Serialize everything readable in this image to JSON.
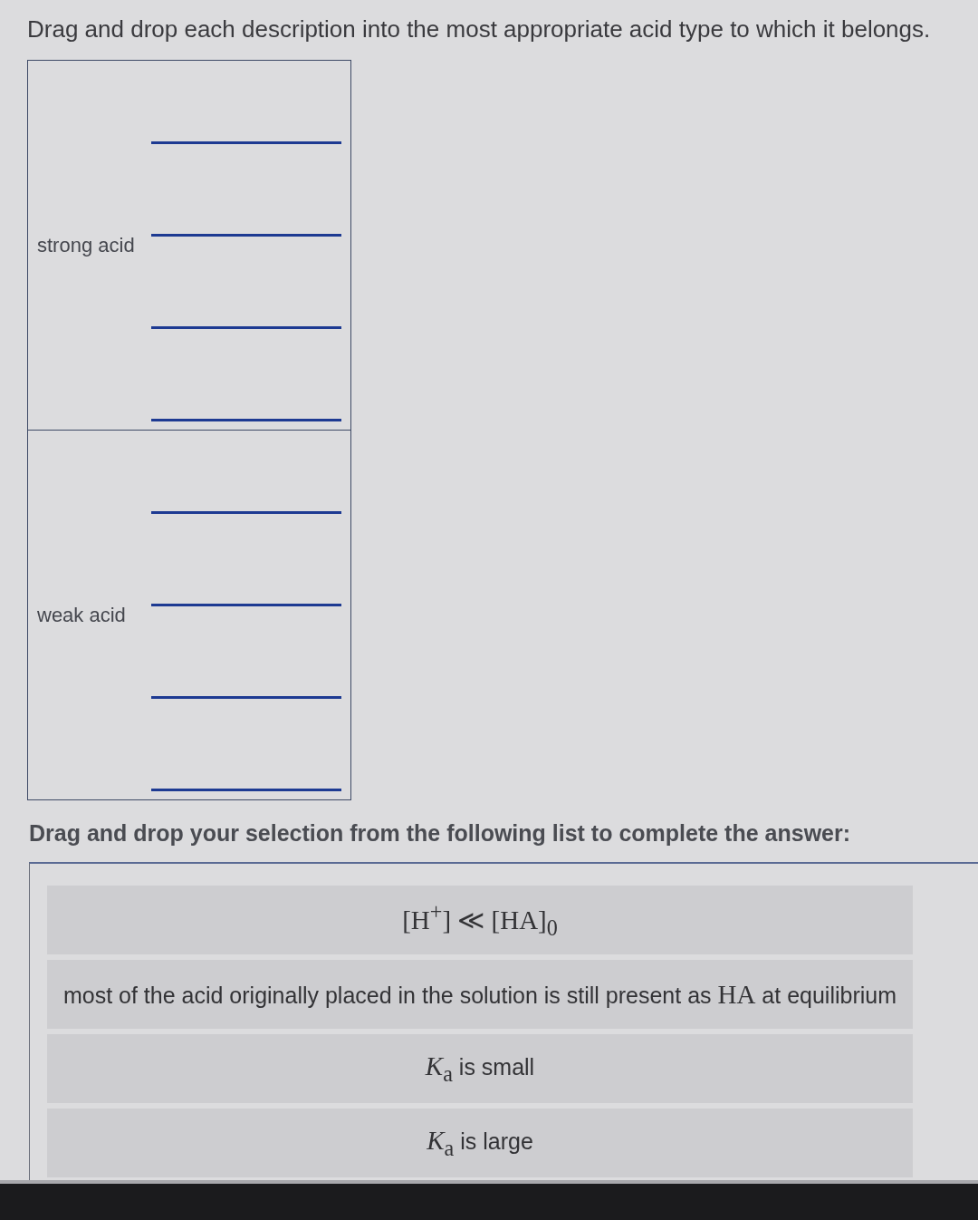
{
  "instruction": "Drag and drop each description into the most appropriate acid type to which it belongs.",
  "categories": [
    {
      "label": "strong acid",
      "blanks": [
        {
          "kind": "line"
        },
        {
          "kind": "line"
        },
        {
          "kind": "line"
        },
        {
          "kind": "line"
        }
      ]
    },
    {
      "label": "weak acid",
      "blanks": [
        {
          "kind": "line"
        },
        {
          "kind": "line"
        },
        {
          "kind": "line"
        },
        {
          "kind": "line"
        }
      ]
    }
  ],
  "list_prompt": "Drag and drop your selection from the following list to complete the answer:",
  "options": [
    {
      "segments": [
        {
          "kind": "math",
          "text": "[H$^{+}$] ≪ [HA]$_{0}$"
        }
      ]
    },
    {
      "segments": [
        {
          "kind": "text",
          "text": "most of the acid originally placed in the solution is still present as "
        },
        {
          "kind": "math",
          "text": "HA"
        },
        {
          "kind": "text",
          "text": " at equilibrium"
        }
      ]
    },
    {
      "segments": [
        {
          "kind": "math",
          "text": "*K*$_{a}$"
        },
        {
          "kind": "text",
          "text": " is small"
        }
      ]
    },
    {
      "segments": [
        {
          "kind": "math",
          "text": "*K*$_{a}$"
        },
        {
          "kind": "text",
          "text": " is large"
        }
      ]
    }
  ]
}
